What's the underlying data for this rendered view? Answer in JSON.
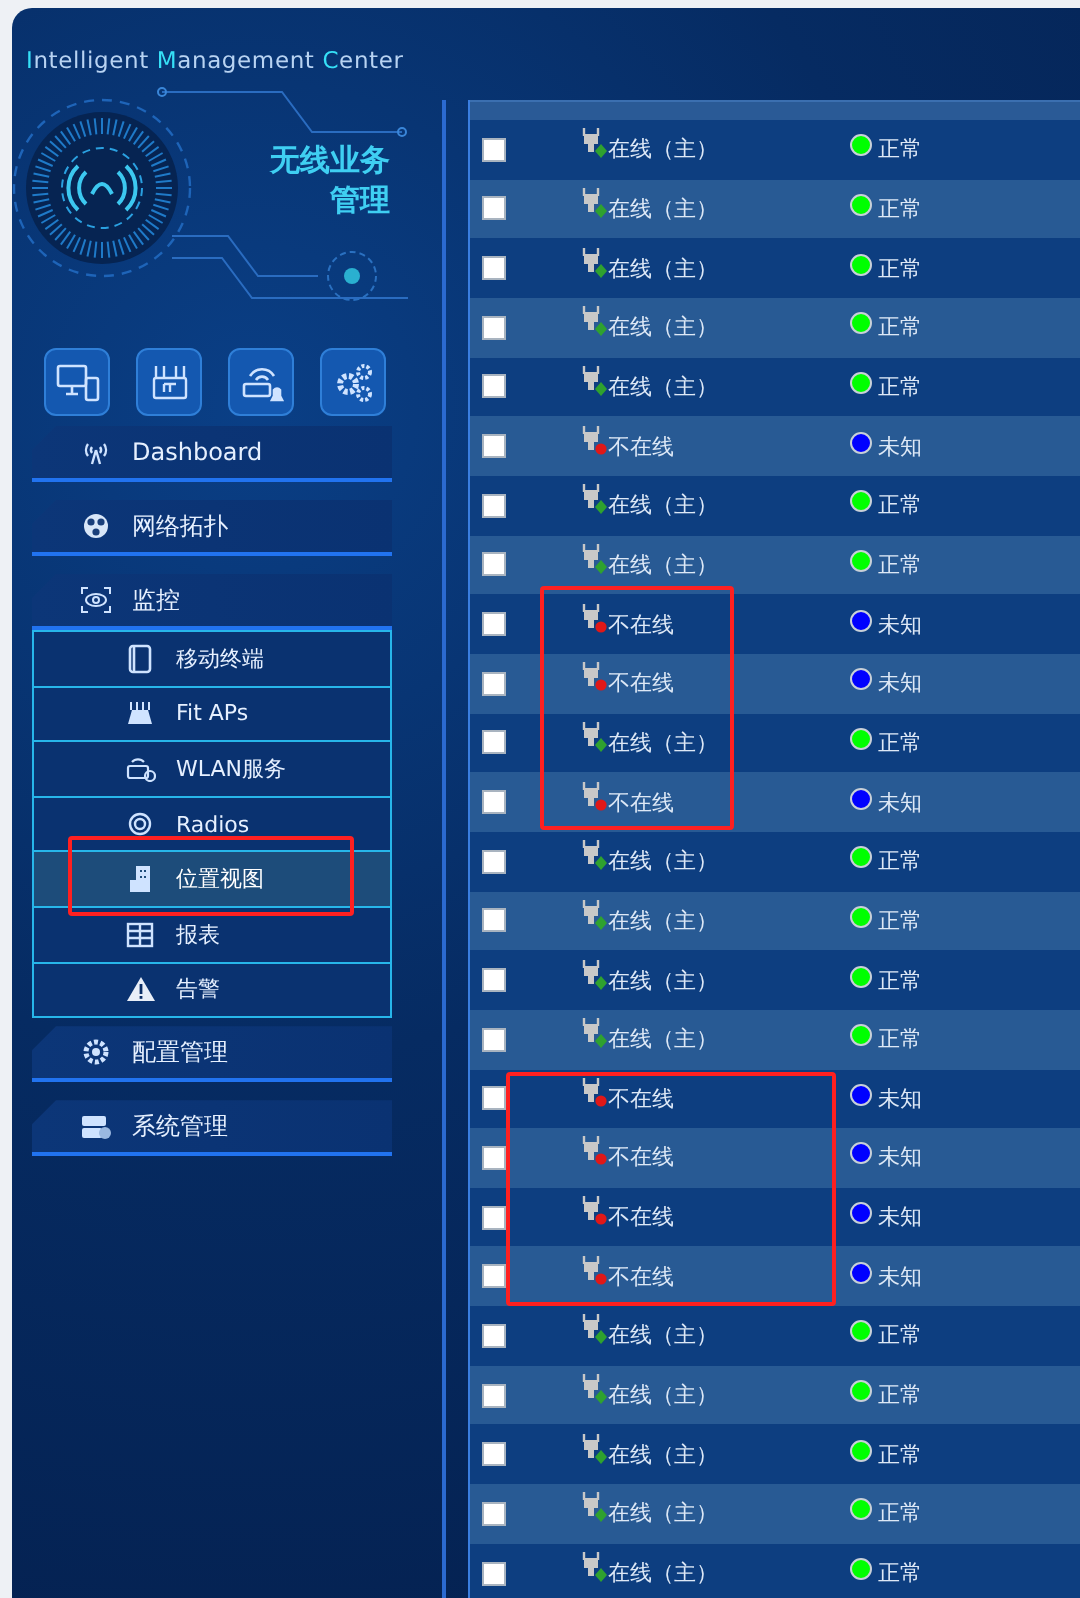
{
  "app": {
    "title": "Intelligent Management Center",
    "logo_lines": [
      "无线业务",
      "管理"
    ]
  },
  "menu": [
    {
      "label": "Dashboard",
      "expanded": false
    },
    {
      "label": "网络拓扑",
      "expanded": false
    },
    {
      "label": "监控",
      "expanded": true,
      "children": [
        {
          "label": "移动终端",
          "selected": false
        },
        {
          "label": "Fit APs",
          "selected": false
        },
        {
          "label": "WLAN服务",
          "selected": false
        },
        {
          "label": "Radios",
          "selected": false
        },
        {
          "label": "位置视图",
          "selected": true
        },
        {
          "label": "报表",
          "selected": false
        },
        {
          "label": "告警",
          "selected": false
        }
      ]
    },
    {
      "label": "配置管理",
      "expanded": false
    },
    {
      "label": "系统管理",
      "expanded": false
    }
  ],
  "table": {
    "rows": [
      {
        "checked": false,
        "status": "在线（主）",
        "online": true,
        "health": "正常",
        "color": "#00ff00"
      },
      {
        "checked": false,
        "status": "在线（主）",
        "online": true,
        "health": "正常",
        "color": "#00ff00"
      },
      {
        "checked": false,
        "status": "在线（主）",
        "online": true,
        "health": "正常",
        "color": "#00ff00"
      },
      {
        "checked": false,
        "status": "在线（主）",
        "online": true,
        "health": "正常",
        "color": "#00ff00"
      },
      {
        "checked": false,
        "status": "在线（主）",
        "online": true,
        "health": "正常",
        "color": "#00ff00"
      },
      {
        "checked": false,
        "status": "不在线",
        "online": false,
        "health": "未知",
        "color": "#0000ff"
      },
      {
        "checked": false,
        "status": "在线（主）",
        "online": true,
        "health": "正常",
        "color": "#00ff00"
      },
      {
        "checked": false,
        "status": "在线（主）",
        "online": true,
        "health": "正常",
        "color": "#00ff00"
      },
      {
        "checked": false,
        "status": "不在线",
        "online": false,
        "health": "未知",
        "color": "#0000ff"
      },
      {
        "checked": false,
        "status": "不在线",
        "online": false,
        "health": "未知",
        "color": "#0000ff"
      },
      {
        "checked": false,
        "status": "在线（主）",
        "online": true,
        "health": "正常",
        "color": "#00ff00"
      },
      {
        "checked": false,
        "status": "不在线",
        "online": false,
        "health": "未知",
        "color": "#0000ff"
      },
      {
        "checked": false,
        "status": "在线（主）",
        "online": true,
        "health": "正常",
        "color": "#00ff00"
      },
      {
        "checked": false,
        "status": "在线（主）",
        "online": true,
        "health": "正常",
        "color": "#00ff00"
      },
      {
        "checked": false,
        "status": "在线（主）",
        "online": true,
        "health": "正常",
        "color": "#00ff00"
      },
      {
        "checked": false,
        "status": "在线（主）",
        "online": true,
        "health": "正常",
        "color": "#00ff00"
      },
      {
        "checked": false,
        "status": "不在线",
        "online": false,
        "health": "未知",
        "color": "#0000ff"
      },
      {
        "checked": false,
        "status": "不在线",
        "online": false,
        "health": "未知",
        "color": "#0000ff"
      },
      {
        "checked": false,
        "status": "不在线",
        "online": false,
        "health": "未知",
        "color": "#0000ff"
      },
      {
        "checked": false,
        "status": "不在线",
        "online": false,
        "health": "未知",
        "color": "#0000ff"
      },
      {
        "checked": false,
        "status": "在线（主）",
        "online": true,
        "health": "正常",
        "color": "#00ff00"
      },
      {
        "checked": false,
        "status": "在线（主）",
        "online": true,
        "health": "正常",
        "color": "#00ff00"
      },
      {
        "checked": false,
        "status": "在线（主）",
        "online": true,
        "health": "正常",
        "color": "#00ff00"
      },
      {
        "checked": false,
        "status": "在线（主）",
        "online": true,
        "health": "正常",
        "color": "#00ff00"
      },
      {
        "checked": false,
        "status": "在线（主）",
        "online": true,
        "health": "正常",
        "color": "#00ff00"
      }
    ]
  },
  "annotations": [
    {
      "kind": "rectangle",
      "color": "#ff2020"
    },
    {
      "kind": "rectangle",
      "color": "#ff2020"
    },
    {
      "kind": "rectangle",
      "color": "#ff2020"
    }
  ]
}
